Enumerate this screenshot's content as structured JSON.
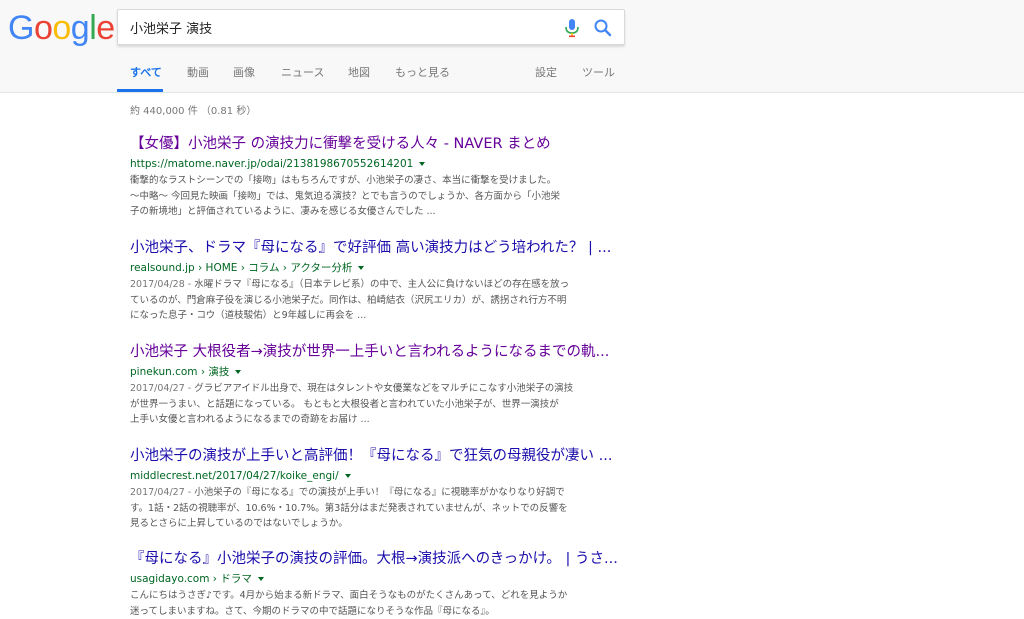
{
  "logo": {
    "letters": [
      "G",
      "o",
      "o",
      "g",
      "l",
      "e"
    ],
    "colors": [
      "#4285F4",
      "#EA4335",
      "#FBBC05",
      "#4285F4",
      "#34A853",
      "#EA4335"
    ]
  },
  "search": {
    "query": "小池栄子 演技"
  },
  "tabs": [
    {
      "label": "すべて",
      "active": true
    },
    {
      "label": "動画"
    },
    {
      "label": "画像"
    },
    {
      "label": "ニュース"
    },
    {
      "label": "地図"
    },
    {
      "label": "もっと見る"
    },
    {
      "label": "設定"
    },
    {
      "label": "ツール"
    }
  ],
  "stats": "約 440,000 件 （0.81 秒）",
  "results": [
    {
      "title": "【女優】小池栄子 の演技力に衝撃を受ける人々 - NAVER まとめ",
      "url": "https://matome.naver.jp/odai/2138198670552614201",
      "snippet": [
        "衝撃的なラストシーンでの「接吻」はもちろんですが、小池栄子の凄さ、本当に衝撃を受けました。",
        "〜中略〜 今回見た映画「接吻」では、鬼気迫る演技？とでも言うのでしょうか、各方面から「小池栄",
        "子の新境地」と評価されているように、凄みを感じる女優さんでした ..."
      ]
    },
    {
      "title": "小池栄子、ドラマ『母になる』で好評価 高い演技力はどう培われた？ | ...",
      "url": "realsound.jp › HOME › コラム › アクター分析",
      "date": "2017/04/28 - ",
      "snippet": [
        "水曜ドラマ『母になる』（日本テレビ系）の中で、主人公に負けないほどの存在感を放っ",
        "ているのが、門倉麻子役を演じる小池栄子だ。同作は、柏崎結衣（沢尻エリカ）が、誘拐され行方不明",
        "になった息子・コウ（道枝駿佑）と9年越しに再会を ..."
      ]
    },
    {
      "title": "小池栄子 大根役者→演技が世界一上手いと言われるようになるまでの軌...",
      "url": "pinekun.com › 演技",
      "date": "2017/04/27 - ",
      "snippet": [
        "グラビアアイドル出身で、現在はタレントや女優業などをマルチにこなす小池栄子の演技",
        "が世界一うまい、と話題になっている。 もともと大根役者と言われていた小池栄子が、世界一演技が",
        "上手い女優と言われるようになるまでの奇跡をお届け ..."
      ]
    },
    {
      "title": "小池栄子の演技が上手いと高評価！『母になる』で狂気の母親役が凄い ...",
      "url": "middlecrest.net/2017/04/27/koike_engi/",
      "date": "2017/04/27 - ",
      "snippet": [
        "小池栄子の『母になる』での演技が上手い！『母になる』に視聴率がかなりなり好調で",
        "す。1話・2話の視聴率が、10.6%・10.7%。第3話分はまだ発表されていませんが、ネットでの反響を",
        "見るとさらに上昇しているのではないでしょうか。"
      ]
    },
    {
      "title": "『母になる』小池栄子の演技の評価。大根→演技派へのきっかけ。 | うさ...",
      "url": "usagidayo.com › ドラマ",
      "snippet": [
        "こんにちはうさぎ♪です。4月から始まる新ドラマ、面白そうなものがたくさんあって、どれを見ようか",
        "迷ってしまいますね。さて、今期のドラマの中で話題になりそうな作品『母になる』。"
      ]
    }
  ]
}
